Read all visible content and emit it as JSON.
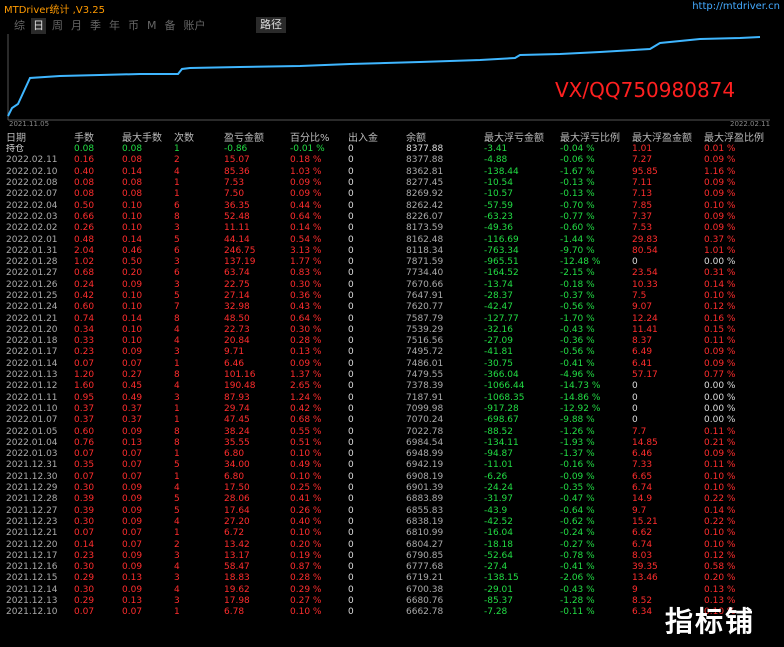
{
  "window": {
    "title": "MTDriver统计 ,V3.25",
    "url": "http://mtdriver.cn"
  },
  "tabs": [
    "综",
    "日",
    "周",
    "月",
    "季",
    "年",
    "币",
    "M",
    "备",
    "账户"
  ],
  "active_tab": "日",
  "path_button": "路径",
  "chart": {
    "start_date": "2021.11.05",
    "end_date": "2022.02.11",
    "line_color": "#3fb6ff"
  },
  "watermark": "VX/QQ750980874",
  "logo_text": "指标铺",
  "columns": [
    "日期",
    "手数",
    "最大手数",
    "次数",
    "盈亏金额",
    "百分比%",
    "出入金",
    "余额",
    "最大浮亏金额",
    "最大浮亏比例",
    "最大浮盈金额",
    "最大浮盈比例"
  ],
  "holding": {
    "label": "持仓",
    "lots": "0.08",
    "max_lots": "0.08",
    "count": "1",
    "pnl": "-0.86",
    "pct": "-0.01 %",
    "flow": "0",
    "balance": "8377.88",
    "max_fl_amt": "-3.41",
    "max_fl_pct": "-0.04 %",
    "max_fp_amt": "1.01",
    "max_fp_pct": "0.01 %"
  },
  "rows": [
    [
      "2022.02.11",
      "0.16",
      "0.08",
      "2",
      "15.07",
      "0.18 %",
      "0",
      "8377.88",
      "-4.88",
      "-0.06 %",
      "7.27",
      "0.09 %"
    ],
    [
      "2022.02.10",
      "0.40",
      "0.14",
      "4",
      "85.36",
      "1.03 %",
      "0",
      "8362.81",
      "-138.44",
      "-1.67 %",
      "95.85",
      "1.16 %"
    ],
    [
      "2022.02.08",
      "0.08",
      "0.08",
      "1",
      "7.53",
      "0.09 %",
      "0",
      "8277.45",
      "-10.54",
      "-0.13 %",
      "7.11",
      "0.09 %"
    ],
    [
      "2022.02.07",
      "0.08",
      "0.08",
      "1",
      "7.50",
      "0.09 %",
      "0",
      "8269.92",
      "-10.57",
      "-0.13 %",
      "7.13",
      "0.09 %"
    ],
    [
      "2022.02.04",
      "0.50",
      "0.10",
      "6",
      "36.35",
      "0.44 %",
      "0",
      "8262.42",
      "-57.59",
      "-0.70 %",
      "7.85",
      "0.10 %"
    ],
    [
      "2022.02.03",
      "0.66",
      "0.10",
      "8",
      "52.48",
      "0.64 %",
      "0",
      "8226.07",
      "-63.23",
      "-0.77 %",
      "7.37",
      "0.09 %"
    ],
    [
      "2022.02.02",
      "0.26",
      "0.10",
      "3",
      "11.11",
      "0.14 %",
      "0",
      "8173.59",
      "-49.36",
      "-0.60 %",
      "7.53",
      "0.09 %"
    ],
    [
      "2022.02.01",
      "0.48",
      "0.14",
      "5",
      "44.14",
      "0.54 %",
      "0",
      "8162.48",
      "-116.69",
      "-1.44 %",
      "29.83",
      "0.37 %"
    ],
    [
      "2022.01.31",
      "2.04",
      "0.46",
      "6",
      "246.75",
      "3.13 %",
      "0",
      "8118.34",
      "-763.34",
      "-9.70 %",
      "80.54",
      "1.01 %"
    ],
    [
      "2022.01.28",
      "1.02",
      "0.50",
      "3",
      "137.19",
      "1.77 %",
      "0",
      "7871.59",
      "-965.51",
      "-12.48 %",
      "0",
      "0.00 %"
    ],
    [
      "2022.01.27",
      "0.68",
      "0.20",
      "6",
      "63.74",
      "0.83 %",
      "0",
      "7734.40",
      "-164.52",
      "-2.15 %",
      "23.54",
      "0.31 %"
    ],
    [
      "2022.01.26",
      "0.24",
      "0.09",
      "3",
      "22.75",
      "0.30 %",
      "0",
      "7670.66",
      "-13.74",
      "-0.18 %",
      "10.33",
      "0.14 %"
    ],
    [
      "2022.01.25",
      "0.42",
      "0.10",
      "5",
      "27.14",
      "0.36 %",
      "0",
      "7647.91",
      "-28.37",
      "-0.37 %",
      "7.5",
      "0.10 %"
    ],
    [
      "2022.01.24",
      "0.60",
      "0.10",
      "7",
      "32.98",
      "0.43 %",
      "0",
      "7620.77",
      "-42.47",
      "-0.56 %",
      "9.07",
      "0.12 %"
    ],
    [
      "2022.01.21",
      "0.74",
      "0.14",
      "8",
      "48.50",
      "0.64 %",
      "0",
      "7587.79",
      "-127.77",
      "-1.70 %",
      "12.24",
      "0.16 %"
    ],
    [
      "2022.01.20",
      "0.34",
      "0.10",
      "4",
      "22.73",
      "0.30 %",
      "0",
      "7539.29",
      "-32.16",
      "-0.43 %",
      "11.41",
      "0.15 %"
    ],
    [
      "2022.01.18",
      "0.33",
      "0.10",
      "4",
      "20.84",
      "0.28 %",
      "0",
      "7516.56",
      "-27.09",
      "-0.36 %",
      "8.37",
      "0.11 %"
    ],
    [
      "2022.01.17",
      "0.23",
      "0.09",
      "3",
      "9.71",
      "0.13 %",
      "0",
      "7495.72",
      "-41.81",
      "-0.56 %",
      "6.49",
      "0.09 %"
    ],
    [
      "2022.01.14",
      "0.07",
      "0.07",
      "1",
      "6.46",
      "0.09 %",
      "0",
      "7486.01",
      "-30.75",
      "-0.41 %",
      "6.41",
      "0.09 %"
    ],
    [
      "2022.01.13",
      "1.20",
      "0.27",
      "8",
      "101.16",
      "1.37 %",
      "0",
      "7479.55",
      "-366.04",
      "-4.96 %",
      "57.17",
      "0.77 %"
    ],
    [
      "2022.01.12",
      "1.60",
      "0.45",
      "4",
      "190.48",
      "2.65 %",
      "0",
      "7378.39",
      "-1066.44",
      "-14.73 %",
      "0",
      "0.00 %"
    ],
    [
      "2022.01.11",
      "0.95",
      "0.49",
      "3",
      "87.93",
      "1.24 %",
      "0",
      "7187.91",
      "-1068.35",
      "-14.86 %",
      "0",
      "0.00 %"
    ],
    [
      "2022.01.10",
      "0.37",
      "0.37",
      "1",
      "29.74",
      "0.42 %",
      "0",
      "7099.98",
      "-917.28",
      "-12.92 %",
      "0",
      "0.00 %"
    ],
    [
      "2022.01.07",
      "0.37",
      "0.37",
      "1",
      "47.45",
      "0.68 %",
      "0",
      "7070.24",
      "-698.67",
      "-9.88 %",
      "0",
      "0.00 %"
    ],
    [
      "2022.01.05",
      "0.60",
      "0.09",
      "8",
      "38.24",
      "0.55 %",
      "0",
      "7022.78",
      "-88.52",
      "-1.26 %",
      "7.7",
      "0.11 %"
    ],
    [
      "2022.01.04",
      "0.76",
      "0.13",
      "8",
      "35.55",
      "0.51 %",
      "0",
      "6984.54",
      "-134.11",
      "-1.93 %",
      "14.85",
      "0.21 %"
    ],
    [
      "2022.01.03",
      "0.07",
      "0.07",
      "1",
      "6.80",
      "0.10 %",
      "0",
      "6948.99",
      "-94.87",
      "-1.37 %",
      "6.46",
      "0.09 %"
    ],
    [
      "2021.12.31",
      "0.35",
      "0.07",
      "5",
      "34.00",
      "0.49 %",
      "0",
      "6942.19",
      "-11.01",
      "-0.16 %",
      "7.33",
      "0.11 %"
    ],
    [
      "2021.12.30",
      "0.07",
      "0.07",
      "1",
      "6.80",
      "0.10 %",
      "0",
      "6908.19",
      "-6.26",
      "-0.09 %",
      "6.65",
      "0.10 %"
    ],
    [
      "2021.12.29",
      "0.30",
      "0.09",
      "4",
      "17.50",
      "0.25 %",
      "0",
      "6901.39",
      "-24.24",
      "-0.35 %",
      "6.74",
      "0.10 %"
    ],
    [
      "2021.12.28",
      "0.39",
      "0.09",
      "5",
      "28.06",
      "0.41 %",
      "0",
      "6883.89",
      "-31.97",
      "-0.47 %",
      "14.9",
      "0.22 %"
    ],
    [
      "2021.12.27",
      "0.39",
      "0.09",
      "5",
      "17.64",
      "0.26 %",
      "0",
      "6855.83",
      "-43.9",
      "-0.64 %",
      "9.7",
      "0.14 %"
    ],
    [
      "2021.12.23",
      "0.30",
      "0.09",
      "4",
      "27.20",
      "0.40 %",
      "0",
      "6838.19",
      "-42.52",
      "-0.62 %",
      "15.21",
      "0.22 %"
    ],
    [
      "2021.12.21",
      "0.07",
      "0.07",
      "1",
      "6.72",
      "0.10 %",
      "0",
      "6810.99",
      "-16.04",
      "-0.24 %",
      "6.62",
      "0.10 %"
    ],
    [
      "2021.12.20",
      "0.14",
      "0.07",
      "2",
      "13.42",
      "0.20 %",
      "0",
      "6804.27",
      "-18.18",
      "-0.27 %",
      "6.74",
      "0.10 %"
    ],
    [
      "2021.12.17",
      "0.23",
      "0.09",
      "3",
      "13.17",
      "0.19 %",
      "0",
      "6790.85",
      "-52.64",
      "-0.78 %",
      "8.03",
      "0.12 %"
    ],
    [
      "2021.12.16",
      "0.30",
      "0.09",
      "4",
      "58.47",
      "0.87 %",
      "0",
      "6777.68",
      "-27.4",
      "-0.41 %",
      "39.35",
      "0.58 %"
    ],
    [
      "2021.12.15",
      "0.29",
      "0.13",
      "3",
      "18.83",
      "0.28 %",
      "0",
      "6719.21",
      "-138.15",
      "-2.06 %",
      "13.46",
      "0.20 %"
    ],
    [
      "2021.12.14",
      "0.30",
      "0.09",
      "4",
      "19.62",
      "0.29 %",
      "0",
      "6700.38",
      "-29.01",
      "-0.43 %",
      "9",
      "0.13 %"
    ],
    [
      "2021.12.13",
      "0.29",
      "0.13",
      "3",
      "17.98",
      "0.27 %",
      "0",
      "6680.76",
      "-85.37",
      "-1.28 %",
      "8.52",
      "0.13 %"
    ],
    [
      "2021.12.10",
      "0.07",
      "0.07",
      "1",
      "6.78",
      "0.10 %",
      "0",
      "6662.78",
      "-7.28",
      "-0.11 %",
      "6.34",
      "0.10 %"
    ]
  ]
}
